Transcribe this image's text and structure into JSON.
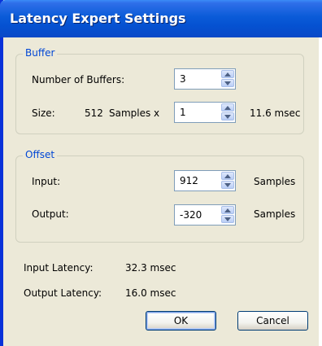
{
  "window": {
    "title": "Latency Expert Settings"
  },
  "buffer": {
    "legend": "Buffer",
    "count_label": "Number of Buffers:",
    "count_value": "3",
    "size_label": "Size:",
    "size_samples": "512",
    "samples_x": "Samples x",
    "multiplier_value": "1",
    "duration": "11.6 msec"
  },
  "offset": {
    "legend": "Offset",
    "input_label": "Input:",
    "input_value": "912",
    "input_unit": "Samples",
    "output_label": "Output:",
    "output_value": "-320",
    "output_unit": "Samples"
  },
  "latency": {
    "input_label": "Input Latency:",
    "input_value": "32.3 msec",
    "output_label": "Output Latency:",
    "output_value": "16.0 msec"
  },
  "buttons": {
    "ok": "OK",
    "cancel": "Cancel"
  }
}
